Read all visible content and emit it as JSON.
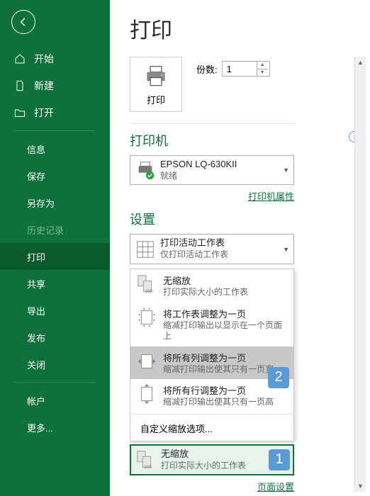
{
  "sidebar": {
    "items": [
      {
        "label": "开始",
        "icon": "home"
      },
      {
        "label": "新建",
        "icon": "file"
      },
      {
        "label": "打开",
        "icon": "folder"
      }
    ],
    "sub_items": [
      {
        "label": "信息"
      },
      {
        "label": "保存"
      },
      {
        "label": "另存为"
      },
      {
        "label": "历史记录",
        "disabled": true
      },
      {
        "label": "打印",
        "active": true
      },
      {
        "label": "共享"
      },
      {
        "label": "导出"
      },
      {
        "label": "发布"
      },
      {
        "label": "关闭"
      }
    ],
    "bottom": [
      {
        "label": "帐户"
      },
      {
        "label": "更多..."
      }
    ]
  },
  "page": {
    "title": "打印",
    "print_button": "打印",
    "copies_label": "份数:",
    "copies_value": "1"
  },
  "printer": {
    "section_label": "打印机",
    "name": "EPSON LQ-630KII",
    "status": "就绪",
    "properties_link": "打印机属性"
  },
  "settings": {
    "section_label": "设置",
    "sheet": {
      "title": "打印活动工作表",
      "subtitle": "仅打印活动工作表"
    },
    "scale_options": [
      {
        "title": "无缩放",
        "subtitle": "打印实际大小的工作表"
      },
      {
        "title": "将工作表调整为一页",
        "subtitle": "缩减打印输出以显示在一个页面上"
      },
      {
        "title": "将所有列调整为一页",
        "subtitle": "缩减打印输出使其只有一页宽"
      },
      {
        "title": "将所有行调整为一页",
        "subtitle": "缩减打印输出使其只有一页高"
      }
    ],
    "custom_scaling": "自定义缩放选项...",
    "current_scale": {
      "title": "无缩放",
      "subtitle": "打印实际大小的工作表"
    },
    "page_setup_link": "页面设置"
  },
  "callouts": {
    "one": "1",
    "two": "2"
  }
}
